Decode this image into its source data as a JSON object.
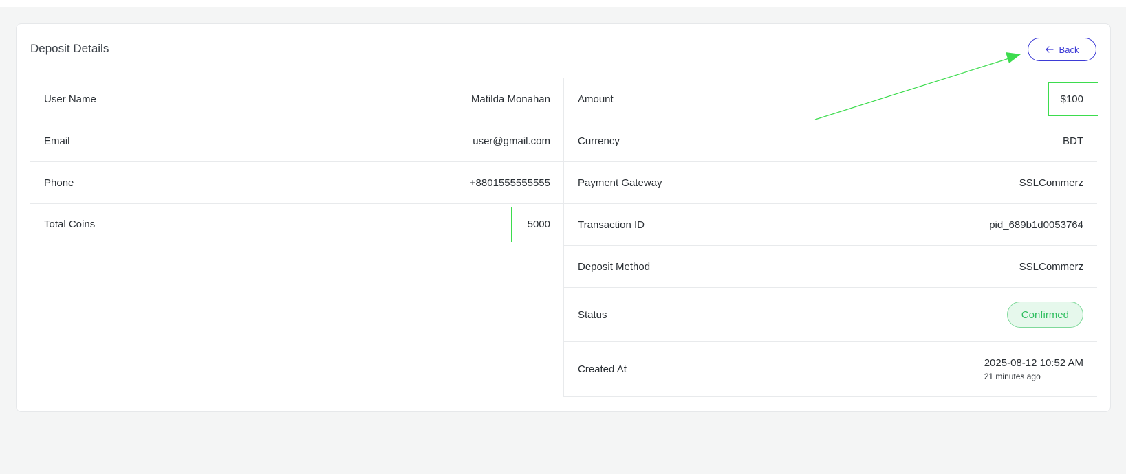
{
  "page": {
    "title": "Deposit Details",
    "back_label": "Back"
  },
  "left_rows": [
    {
      "label": "User Name",
      "value": "Matilda Monahan"
    },
    {
      "label": "Email",
      "value": "user@gmail.com"
    },
    {
      "label": "Phone",
      "value": "+8801555555555"
    },
    {
      "label": "Total Coins",
      "value": "5000"
    }
  ],
  "right_rows": [
    {
      "label": "Amount",
      "value": "$100"
    },
    {
      "label": "Currency",
      "value": "BDT"
    },
    {
      "label": "Payment Gateway",
      "value": "SSLCommerz"
    },
    {
      "label": "Transaction ID",
      "value": "pid_689b1d0053764"
    },
    {
      "label": "Deposit Method",
      "value": "SSLCommerz"
    }
  ],
  "status": {
    "label": "Status",
    "value": "Confirmed"
  },
  "created": {
    "label": "Created At",
    "date": "2025-08-12 10:52 AM",
    "relative": "21 minutes ago"
  },
  "colors": {
    "accent": "#3d3bd6",
    "success": "#2fbe5f",
    "annotation": "#3ddc4e"
  },
  "icons": {
    "back": "arrow-left-icon"
  }
}
